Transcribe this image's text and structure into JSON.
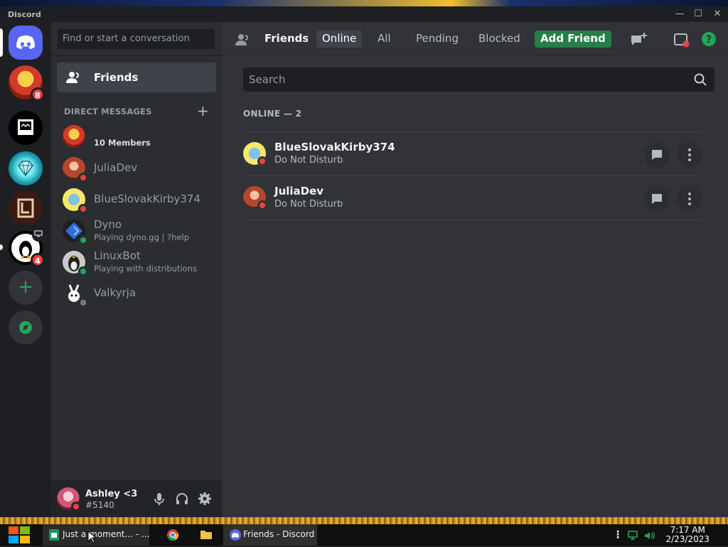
{
  "window": {
    "app_name": "Discord",
    "minimize": "—",
    "maximize": "☐",
    "close": "✕"
  },
  "servers": [
    {
      "name": "Discord Home",
      "icon": "discord-logo-icon",
      "color": "#5865f2"
    },
    {
      "name": "server-1",
      "badge": "8"
    },
    {
      "name": "server-2"
    },
    {
      "name": "server-3"
    },
    {
      "name": "server-4"
    },
    {
      "name": "server-5",
      "badge": "4"
    },
    {
      "name": "Add a Server",
      "icon": "plus-icon"
    },
    {
      "name": "Explore",
      "icon": "compass-icon"
    }
  ],
  "sidebar": {
    "search_placeholder": "Find or start a conversation",
    "friends_label": "Friends",
    "dm_header": "DIRECT MESSAGES",
    "dms": [
      {
        "name": "",
        "sub": "10 Members",
        "status": "none",
        "bold": true
      },
      {
        "name": "JuliaDev",
        "sub": "",
        "status": "dnd"
      },
      {
        "name": "BlueSlovakKirby374",
        "sub": "",
        "status": "dnd"
      },
      {
        "name": "Dyno",
        "sub": "Playing dyno.gg | ?help",
        "status": "online"
      },
      {
        "name": "LinuxBot",
        "sub": "Playing with distributions",
        "status": "online"
      },
      {
        "name": "Valkyrja",
        "sub": "",
        "status": "offline"
      }
    ]
  },
  "user": {
    "name": "Ashley <3",
    "tag": "#5140",
    "status": "dnd"
  },
  "topbar": {
    "friends": "Friends",
    "tabs": [
      "Online",
      "All",
      "Pending",
      "Blocked"
    ],
    "selected_tab": "Online",
    "add_friend": "Add Friend"
  },
  "main": {
    "search_placeholder": "Search",
    "online_header": "ONLINE — 2",
    "friends": [
      {
        "name": "BlueSlovakKirby374",
        "status_text": "Do Not Disturb"
      },
      {
        "name": "JuliaDev",
        "status_text": "Do Not Disturb"
      }
    ]
  },
  "taskbar": {
    "items": [
      {
        "label": "Just a moment... - ...",
        "icon": "sheets-icon"
      },
      {
        "label": "",
        "icon": "chrome-icon"
      },
      {
        "label": "",
        "icon": "folder-icon"
      },
      {
        "label": "Friends - Discord",
        "icon": "discord-icon",
        "active": true
      }
    ],
    "time": "7:17 AM",
    "date": "2/23/2023"
  },
  "colors": {
    "dnd": "#f23f43",
    "online": "#23a55a",
    "offline": "#80848e",
    "accent": "#5865f2",
    "green": "#248046"
  }
}
